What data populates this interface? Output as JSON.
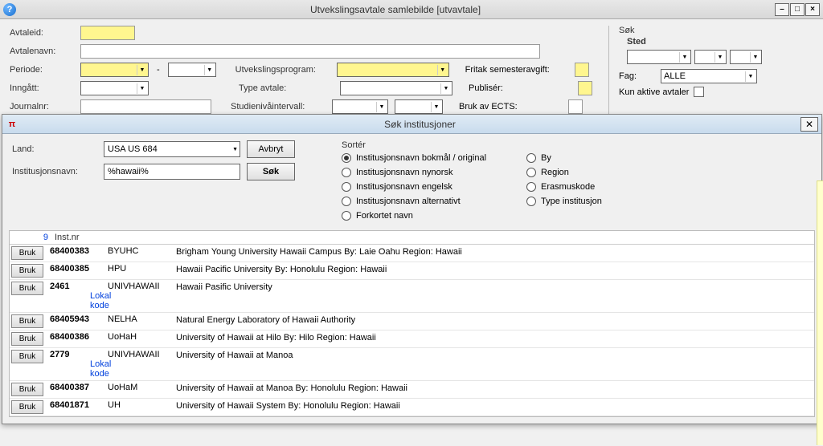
{
  "window": {
    "title": "Utvekslingsavtale samlebilde  [utvavtale]"
  },
  "form": {
    "labels": {
      "avtaleid": "Avtaleid:",
      "avtalenavn": "Avtalenavn:",
      "periode": "Periode:",
      "inngatt": "Inngått:",
      "journalnr": "Journalnr:",
      "utvekslingsprogram": "Utvekslingsprogram:",
      "typeavtale": "Type avtale:",
      "studienivointervall": "Studienivåintervall:",
      "fritak": "Fritak semesteravgift:",
      "publiser": "Publisér:",
      "bruk_ects": "Bruk av ECTS:"
    },
    "values": {
      "avtaleid": "",
      "avtalenavn": "",
      "periode_from": "",
      "periode_to": "",
      "inngatt": "",
      "journalnr": "",
      "utvekslingsprogram": "",
      "typeavtale": "",
      "studieniva_from": "",
      "studieniva_to": ""
    }
  },
  "sidepanel": {
    "sok": "Søk",
    "sted": "Sted",
    "fag_label": "Fag:",
    "fag_value": "ALLE",
    "kun_aktive": "Kun aktive avtaler"
  },
  "dialog": {
    "title": "Søk institusjoner",
    "land_label": "Land:",
    "land_value": "USA US 684",
    "instnavn_label": "Institusjonsnavn:",
    "instnavn_value": "%hawaii%",
    "btn_avbryt": "Avbryt",
    "btn_sok": "Søk",
    "sort": {
      "title": "Sortér",
      "left": [
        "Institusjonsnavn bokmål / original",
        "Institusjonsnavn nynorsk",
        "Institusjonsnavn engelsk",
        "Institusjonsnavn alternativt",
        "Forkortet navn"
      ],
      "right": [
        "By",
        "Region",
        "Erasmuskode",
        "Type institusjon"
      ],
      "selected": 0
    },
    "grid": {
      "count": "9",
      "header": "Inst.nr",
      "bruk": "Bruk",
      "rows": [
        {
          "inst": "68400383",
          "code": "BYUHC",
          "desc": "Brigham Young University Hawaii Campus By: Laie Oahu Region: Hawaii",
          "lokal": false
        },
        {
          "inst": "68400385",
          "code": "HPU",
          "desc": "Hawaii Pacific University By: Honolulu Region: Hawaii",
          "lokal": false
        },
        {
          "inst": "2461",
          "code": "UNIVHAWAII",
          "desc": "Hawaii Pasific University",
          "lokal": true
        },
        {
          "inst": "68405943",
          "code": "NELHA",
          "desc": "Natural Energy Laboratory of Hawaii Authority",
          "lokal": false
        },
        {
          "inst": "68400386",
          "code": "UoHaH",
          "desc": "University of Hawaii at Hilo By: Hilo Region: Hawaii",
          "lokal": false
        },
        {
          "inst": "2779",
          "code": "UNIVHAWAII",
          "desc": "University of Hawaii at Manoa",
          "lokal": true
        },
        {
          "inst": "68400387",
          "code": "UoHaM",
          "desc": "University of Hawaii at Manoa By: Honolulu Region: Hawaii",
          "lokal": false
        },
        {
          "inst": "68401871",
          "code": "UH",
          "desc": "University of Hawaii System By: Honolulu Region: Hawaii",
          "lokal": false
        }
      ],
      "lokal_text": "Lokal kode"
    }
  }
}
